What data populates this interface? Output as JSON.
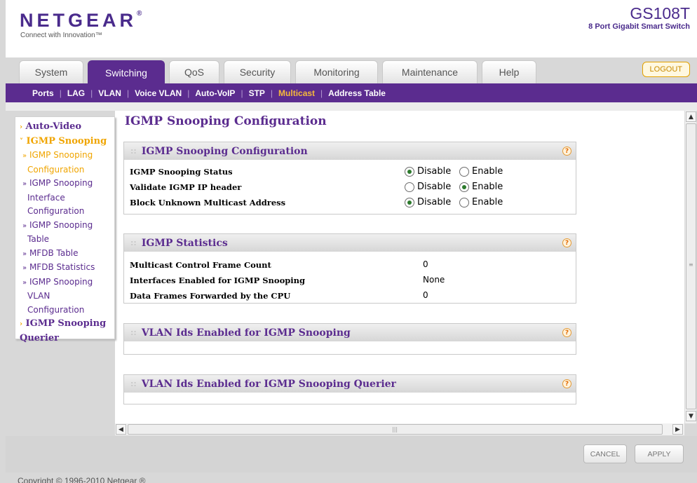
{
  "brand": {
    "logo": "NETGEAR",
    "tagline": "Connect with Innovation™",
    "model": "GS108T",
    "model_desc": "8 Port Gigabit Smart Switch",
    "primary_color": "#5b2c8f",
    "accent_color": "#f0a500"
  },
  "tabs": [
    {
      "label": "System"
    },
    {
      "label": "Switching"
    },
    {
      "label": "QoS"
    },
    {
      "label": "Security"
    },
    {
      "label": "Monitoring"
    },
    {
      "label": "Maintenance"
    },
    {
      "label": "Help"
    }
  ],
  "logout_label": "LOGOUT",
  "subnav": [
    "Ports",
    "LAG",
    "VLAN",
    "Voice VLAN",
    "Auto-VoIP",
    "STP",
    "Multicast",
    "Address Table"
  ],
  "subnav_active": "Multicast",
  "leftmenu": {
    "auto_video": "Auto-Video",
    "igmp_snooping": "IGMP Snooping",
    "items": [
      {
        "line1": "IGMP Snooping",
        "line2": "Configuration"
      },
      {
        "line1": "IGMP Snooping",
        "line2": "Interface",
        "line3": "Configuration"
      },
      {
        "line1": "IGMP Snooping",
        "line2": "Table"
      },
      {
        "line1": "MFDB Table"
      },
      {
        "line1": "MFDB Statistics"
      },
      {
        "line1": "IGMP Snooping",
        "line2": "VLAN",
        "line3": "Configuration"
      }
    ],
    "querier_line1": "IGMP Snooping",
    "querier_line2": "Querier"
  },
  "page_title": "IGMP Snooping Configuration",
  "config_panel": {
    "title": "IGMP Snooping Configuration",
    "rows": [
      {
        "label": "IGMP Snooping Status",
        "selected": "Disable"
      },
      {
        "label": "Validate IGMP IP header",
        "selected": "Enable"
      },
      {
        "label": "Block Unknown Multicast Address",
        "selected": "Disable"
      }
    ],
    "disable_label": "Disable",
    "enable_label": "Enable"
  },
  "stats_panel": {
    "title": "IGMP Statistics",
    "rows": [
      {
        "label": "Multicast Control Frame Count",
        "value": "0"
      },
      {
        "label": "Interfaces Enabled for IGMP Snooping",
        "value": "None"
      },
      {
        "label": "Data Frames Forwarded by the CPU",
        "value": "0"
      }
    ]
  },
  "vlan_panel": {
    "title": "VLAN Ids Enabled for IGMP Snooping"
  },
  "querier_panel": {
    "title": "VLAN Ids Enabled for IGMP Snooping Querier"
  },
  "help_glyph": "?",
  "buttons": {
    "cancel": "CANCEL",
    "apply": "APPLY"
  },
  "copyright": "Copyright © 1996-2010 Netgear ®"
}
